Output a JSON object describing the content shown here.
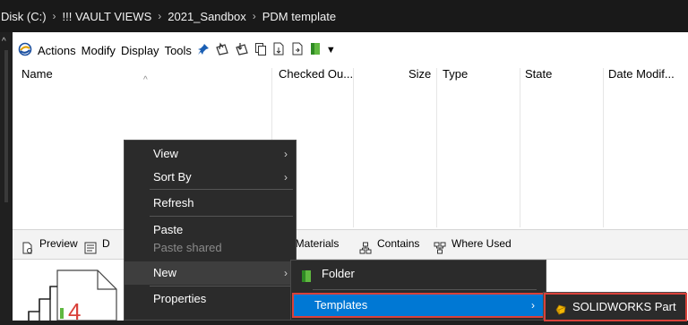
{
  "breadcrumb": [
    "Disk (C:)",
    "!!! VAULT VIEWS",
    "2021_Sandbox",
    "PDM template"
  ],
  "toolbar": {
    "items": [
      "Actions",
      "Modify",
      "Display",
      "Tools"
    ]
  },
  "columns": [
    "Name",
    "Checked Ou...",
    "Size",
    "Type",
    "State",
    "Date Modif..."
  ],
  "tabs": [
    "Preview",
    "D",
    "f Materials",
    "Contains",
    "Where Used"
  ],
  "thumbnail": {
    "digit": "4"
  },
  "context_menu": {
    "items": [
      {
        "label": "View",
        "submenu": true
      },
      {
        "label": "Sort By",
        "submenu": true
      },
      {
        "label": "Refresh",
        "submenu": false
      },
      {
        "label": "Paste",
        "submenu": false
      },
      {
        "label": "Paste shared",
        "submenu": false,
        "disabled": true
      },
      {
        "label": "New",
        "submenu": true,
        "highlighted": true
      },
      {
        "label": "Properties",
        "submenu": false
      }
    ]
  },
  "new_submenu": {
    "items": [
      {
        "label": "Folder",
        "icon": "folder-icon"
      },
      {
        "label": "Templates",
        "icon": "none",
        "submenu": true,
        "highlighted": true
      }
    ]
  },
  "templates_submenu": {
    "items": [
      {
        "label": "SOLIDWORKS Part",
        "icon": "solidworks-part-icon"
      }
    ]
  },
  "colors": {
    "accent": "#0078d4",
    "highlight_box": "#d9413a",
    "menu_bg": "#2b2b2b",
    "green_icon": "#5fb840"
  }
}
